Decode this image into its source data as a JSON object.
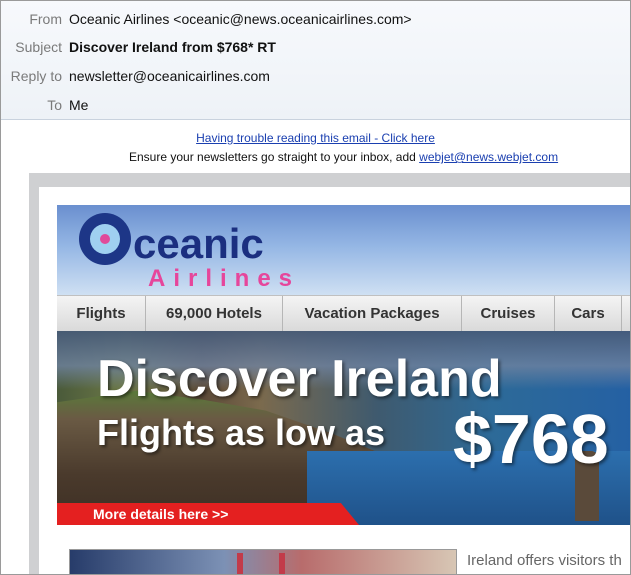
{
  "email": {
    "from_label": "From",
    "from_value": "Oceanic Airlines <oceanic@news.oceanicairlines.com>",
    "subject_label": "Subject",
    "subject_value": "Discover Ireland from $768* RT",
    "reply_label": "Reply to",
    "reply_value": "newsletter@oceanicairlines.com",
    "to_label": "To",
    "to_value": "Me"
  },
  "notices": {
    "trouble_link": "Having trouble reading this email - Click here",
    "inbox_prefix": "Ensure your newsletters go straight to your inbox, add ",
    "inbox_link": "webjet@news.webjet.com"
  },
  "brand": {
    "word": "ceanic",
    "sub": "Airlines",
    "colors": {
      "navy": "#1b2f80",
      "pink": "#e6469b",
      "red": "#e42020",
      "link": "#1a3fb0"
    }
  },
  "nav": {
    "items": [
      "Flights",
      "69,000 Hotels",
      "Vacation Packages",
      "Cruises",
      "Cars"
    ]
  },
  "hero": {
    "title": "Discover Ireland",
    "subtitle": "Flights as low as",
    "price": "$768",
    "cta": "More details here >>"
  },
  "body": {
    "intro": "Ireland offers visitors th"
  }
}
